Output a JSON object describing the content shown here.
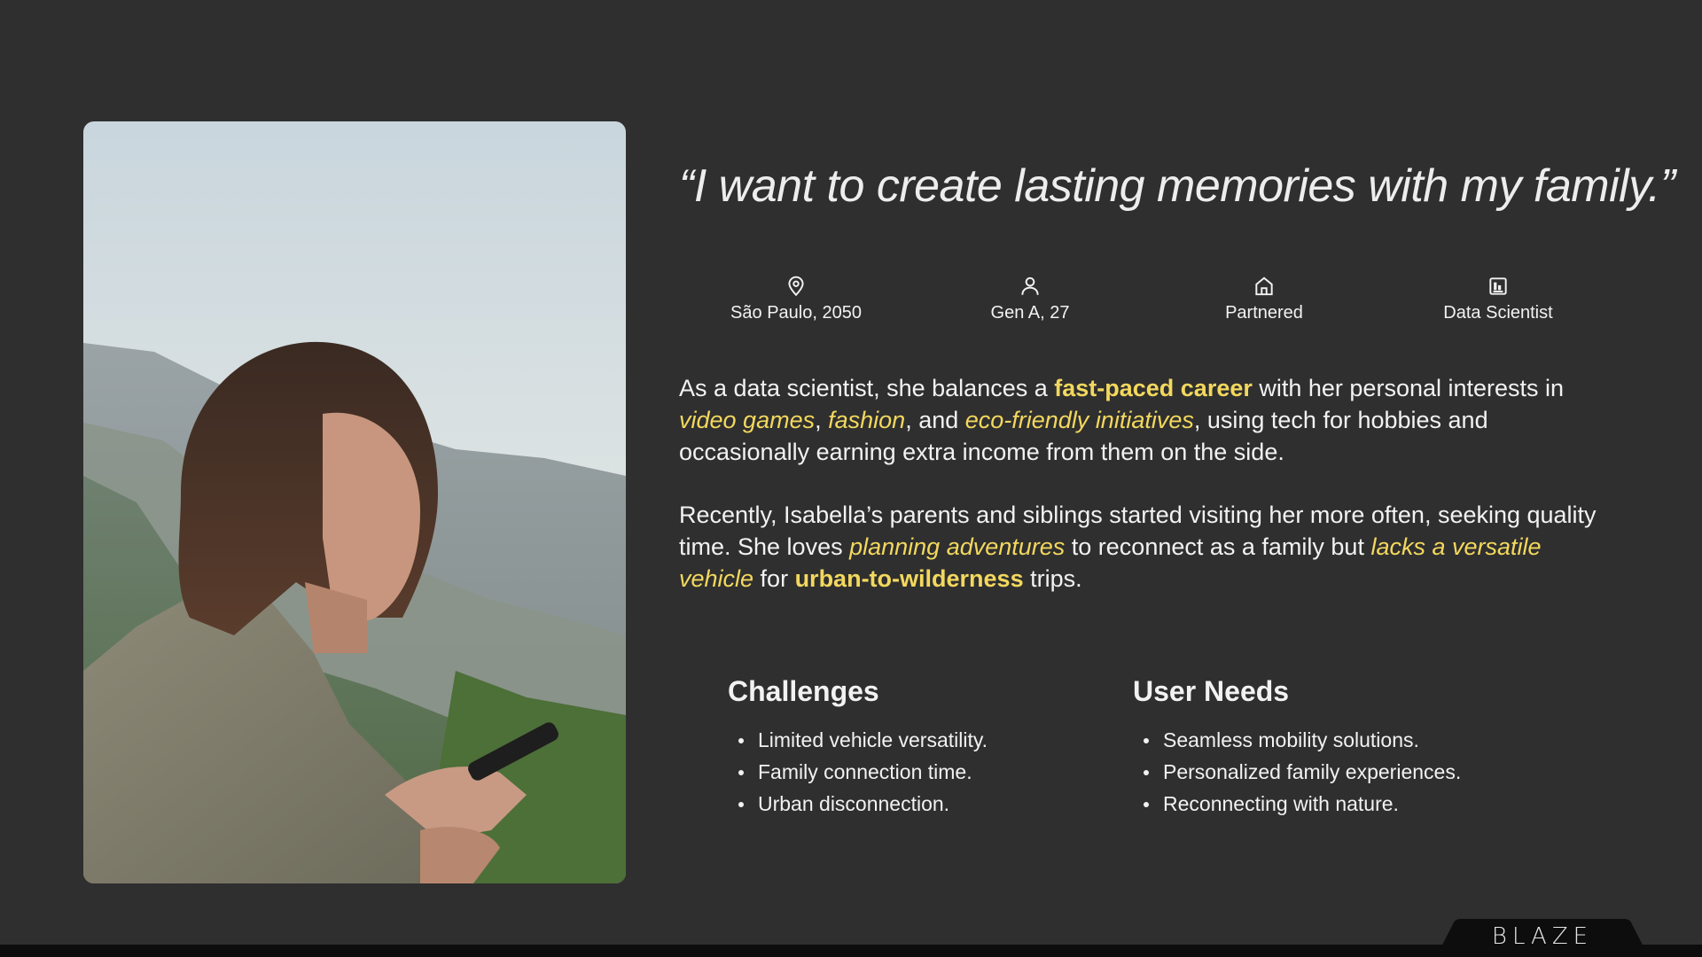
{
  "quote": "“I want to create lasting memories with my family.”",
  "attributes": [
    {
      "icon": "location-pin-icon",
      "label": "São Paulo, 2050"
    },
    {
      "icon": "person-icon",
      "label": "Gen A, 27"
    },
    {
      "icon": "home-icon",
      "label": "Partnered"
    },
    {
      "icon": "briefcase-chart-icon",
      "label": "Data Scientist"
    }
  ],
  "paragraph1": {
    "t1": "As a data scientist, she balances a ",
    "h1": "fast-paced career",
    "t2": " with her personal interests in ",
    "h2": "video games",
    "t3": ", ",
    "h3": "fashion",
    "t4": ", and ",
    "h4": "eco-friendly initiatives",
    "t5": ", using tech for hobbies and occasionally earning extra income from them on the side."
  },
  "paragraph2": {
    "t1": "Recently, Isabella’s parents and siblings started visiting her more often, seeking quality time. She loves ",
    "h1": "planning adventures",
    "t2": " to reconnect as a family but ",
    "h2": "lacks a versatile vehicle",
    "t3": " for ",
    "h3": "urban-to-wilderness",
    "t4": " trips."
  },
  "challenges": {
    "title": "Challenges",
    "items": [
      "Limited vehicle versatility.",
      "Family connection time.",
      "Urban disconnection."
    ]
  },
  "user_needs": {
    "title": "User Needs",
    "items": [
      "Seamless mobility solutions.",
      "Personalized family experiences.",
      "Reconnecting with nature."
    ]
  },
  "brand": {
    "logo": "BLAZE"
  },
  "colors": {
    "background": "#2f2f2f",
    "highlight": "#f3d85e",
    "text": "#f2f2f2",
    "bottom_bar": "#0d0d0d"
  }
}
